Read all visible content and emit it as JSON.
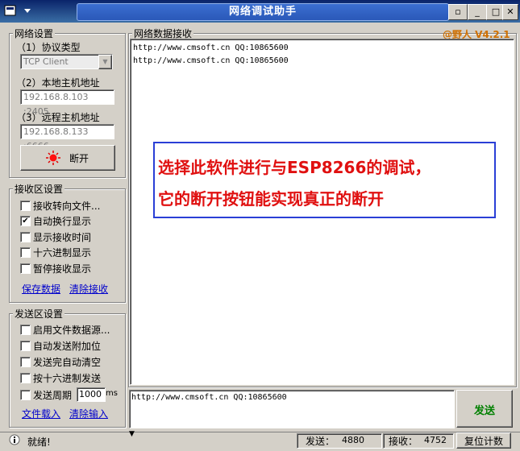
{
  "window": {
    "title": "网络调试助手",
    "version": "@野人 V4.2.1"
  },
  "net_settings": {
    "group_title": "网络设置",
    "protocol_label": "（1）协议类型",
    "protocol_value": "TCP Client",
    "local_label": "（2）本地主机地址",
    "local_value": "192.168.8.103 :2405",
    "remote_label": "（3）远程主机地址",
    "remote_value": "192.168.8.133 :6666",
    "connect_button": "断开"
  },
  "recv_settings": {
    "group_title": "接收区设置",
    "options": [
      {
        "label": "接收转向文件...",
        "checked": false
      },
      {
        "label": "自动换行显示",
        "checked": true
      },
      {
        "label": "显示接收时间",
        "checked": false
      },
      {
        "label": "十六进制显示",
        "checked": false
      },
      {
        "label": "暂停接收显示",
        "checked": false
      }
    ],
    "save_link": "保存数据",
    "clear_link": "清除接收"
  },
  "send_settings": {
    "group_title": "发送区设置",
    "options": [
      {
        "label": "启用文件数据源...",
        "checked": false
      },
      {
        "label": "自动发送附加位",
        "checked": false
      },
      {
        "label": "发送完自动清空",
        "checked": false
      },
      {
        "label": "按十六进制发送",
        "checked": false
      },
      {
        "label": "发送周期",
        "checked": false
      }
    ],
    "period_value": "1000",
    "period_unit": "ms",
    "load_link": "文件载入",
    "clear_link": "清除输入"
  },
  "receive_area": {
    "title": "网络数据接收",
    "lines": [
      "http://www.cmsoft.cn QQ:10865600",
      "http://www.cmsoft.cn QQ:10865600"
    ]
  },
  "annotation": {
    "line1": "选择此软件进行与ESP8266的调试，",
    "line2": "它的断开按钮能实现真正的断开"
  },
  "send_area": {
    "text": "http://www.cmsoft.cn QQ:10865600",
    "send_button": "发送"
  },
  "status": {
    "ready": "就绪!",
    "sent_label": "发送：",
    "sent_value": "4880",
    "recv_label": "接收：",
    "recv_value": "4752",
    "reset_button": "复位计数"
  }
}
